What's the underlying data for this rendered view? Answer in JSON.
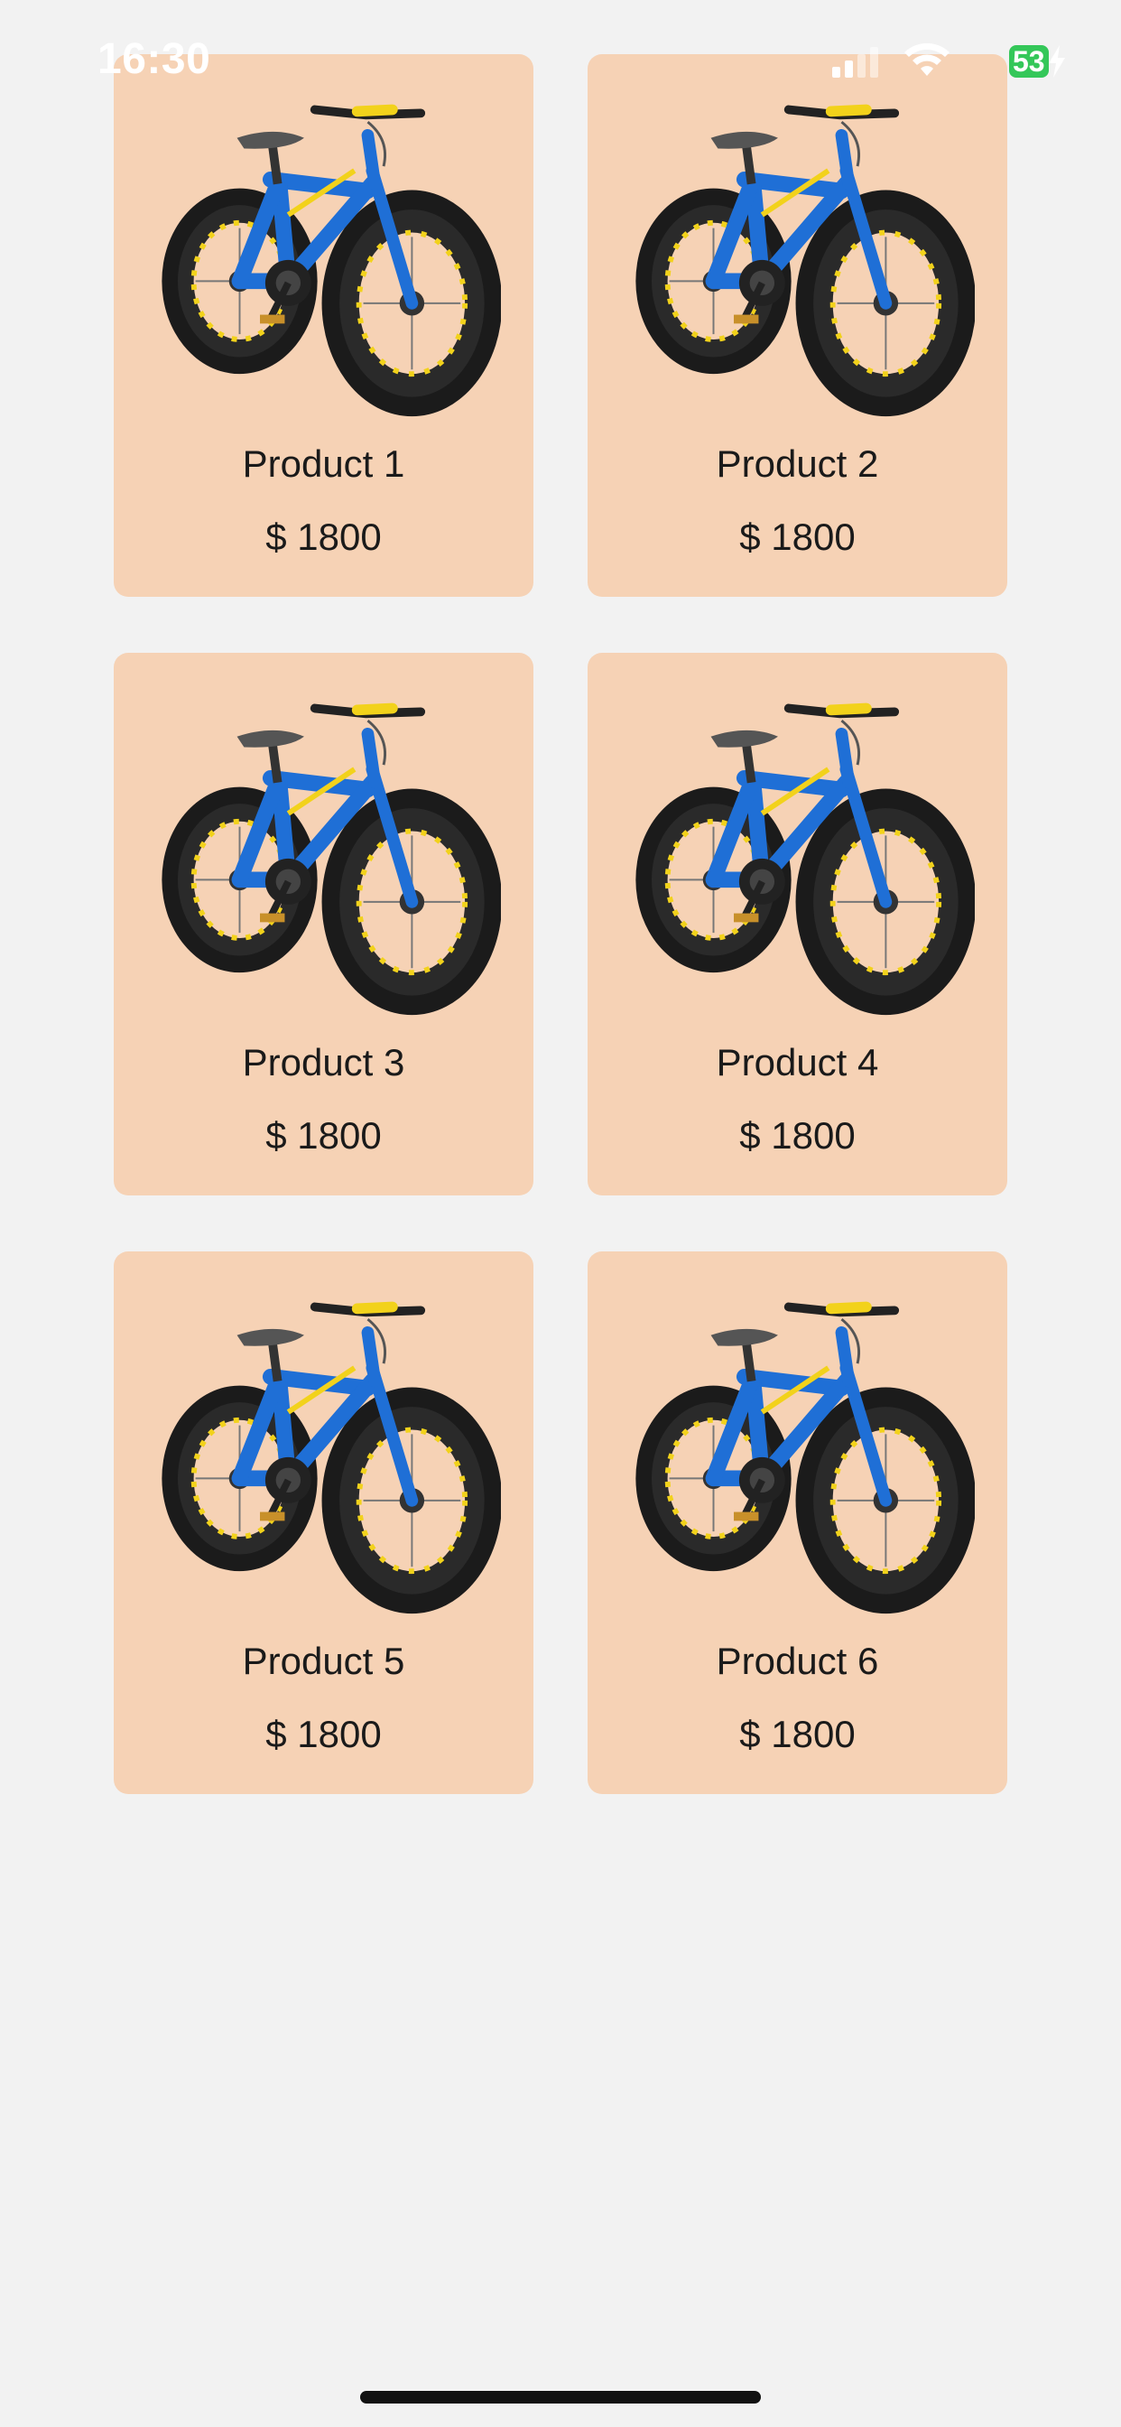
{
  "status_bar": {
    "time": "16:30",
    "battery_percent": "53",
    "icons": [
      "cellular-signal-icon",
      "wifi-icon",
      "battery-icon",
      "charging-bolt-icon"
    ]
  },
  "products": [
    {
      "name": "Product 1",
      "price": "$ 1800",
      "image": "fat-tire-bike-image"
    },
    {
      "name": "Product 2",
      "price": "$ 1800",
      "image": "fat-tire-bike-image"
    },
    {
      "name": "Product 3",
      "price": "$ 1800",
      "image": "fat-tire-bike-image"
    },
    {
      "name": "Product 4",
      "price": "$ 1800",
      "image": "fat-tire-bike-image"
    },
    {
      "name": "Product 5",
      "price": "$ 1800",
      "image": "fat-tire-bike-image"
    },
    {
      "name": "Product 6",
      "price": "$ 1800",
      "image": "fat-tire-bike-image"
    }
  ],
  "colors": {
    "background": "#f2f2f2",
    "card": "#f6d2b5",
    "bike_frame": "#1f6fd6",
    "accent_yellow": "#f2d21b",
    "battery": "#34c759"
  }
}
